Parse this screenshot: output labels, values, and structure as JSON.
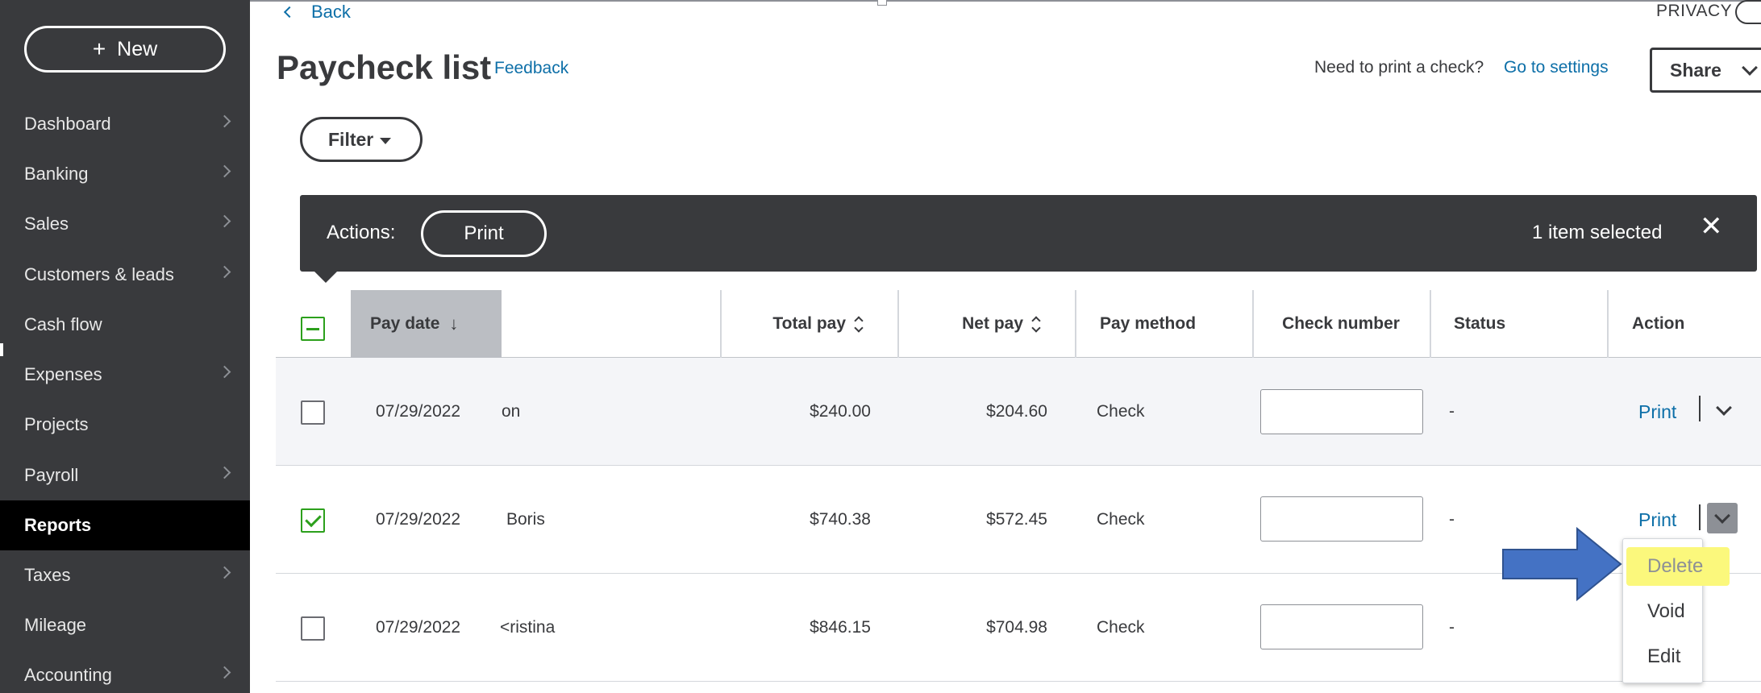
{
  "sidebar": {
    "new_label": "New",
    "items": [
      {
        "label": "Dashboard",
        "has_chevron": true
      },
      {
        "label": "Banking",
        "has_chevron": true
      },
      {
        "label": "Sales",
        "has_chevron": true
      },
      {
        "label": "Customers & leads",
        "has_chevron": true
      },
      {
        "label": "Cash flow",
        "has_chevron": false
      },
      {
        "label": "Expenses",
        "has_chevron": true
      },
      {
        "label": "Projects",
        "has_chevron": false
      },
      {
        "label": "Payroll",
        "has_chevron": true
      },
      {
        "label": "Reports",
        "has_chevron": false,
        "active": true
      },
      {
        "label": "Taxes",
        "has_chevron": true
      },
      {
        "label": "Mileage",
        "has_chevron": false
      },
      {
        "label": "Accounting",
        "has_chevron": true
      }
    ]
  },
  "header": {
    "back_label": "Back",
    "privacy_label": "PRIVACY",
    "title": "Paycheck list",
    "feedback_label": "Feedback",
    "print_question": "Need to print a check?",
    "settings_link": "Go to settings",
    "share_label": "Share"
  },
  "filter": {
    "label": "Filter"
  },
  "actions_bar": {
    "label": "Actions:",
    "print_label": "Print",
    "selected_text": "1 item selected",
    "close_glyph": "✕"
  },
  "table": {
    "columns": {
      "pay_date": "Pay date",
      "total_pay": "Total pay",
      "net_pay": "Net pay",
      "pay_method": "Pay method",
      "check_number": "Check number",
      "status": "Status",
      "action": "Action"
    },
    "rows": [
      {
        "pay_date": "07/29/2022",
        "name": "on",
        "total_pay": "$240.00",
        "net_pay": "$204.60",
        "pay_method": "Check",
        "check_number": "",
        "status": "-",
        "action_label": "Print",
        "checked": false
      },
      {
        "pay_date": "07/29/2022",
        "name": "Boris",
        "total_pay": "$740.38",
        "net_pay": "$572.45",
        "pay_method": "Check",
        "check_number": "",
        "status": "-",
        "action_label": "Print",
        "checked": true
      },
      {
        "pay_date": "07/29/2022",
        "name": "<ristina",
        "total_pay": "$846.15",
        "net_pay": "$704.98",
        "pay_method": "Check",
        "check_number": "",
        "status": "-",
        "action_label": "",
        "checked": false
      }
    ]
  },
  "action_menu": {
    "items": [
      "Delete",
      "Void",
      "Edit"
    ],
    "highlighted": "Delete"
  },
  "colors": {
    "sidebar_bg": "#393a3d",
    "link_blue": "#0d6fa8",
    "check_green": "#2ca01c",
    "highlight_yellow": "#fbf87c",
    "annotation_arrow": "#4472c4"
  }
}
